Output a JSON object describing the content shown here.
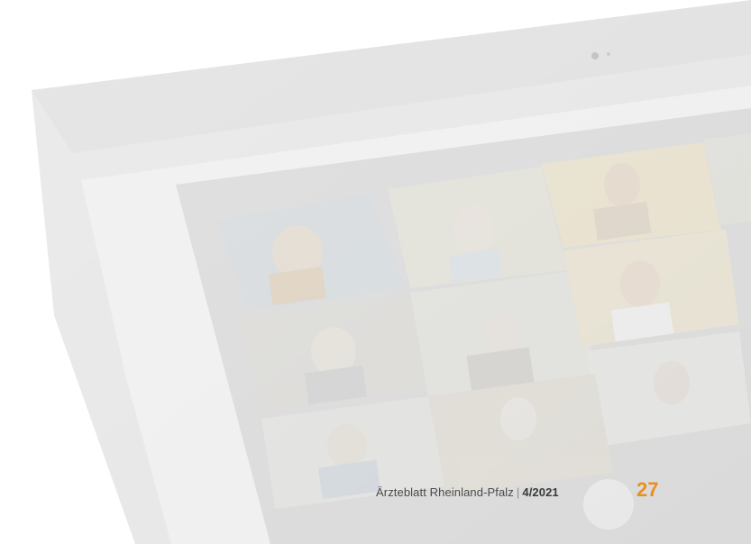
{
  "footer": {
    "publication": "Ärzteblatt Rheinland-Pfalz",
    "separator": "|",
    "issue": "4/2021",
    "page_number": "27"
  },
  "colors": {
    "page_number": "#e8901f",
    "laptop_frame": "#d6d6d6",
    "screen_bg": "#bdbdbd"
  }
}
